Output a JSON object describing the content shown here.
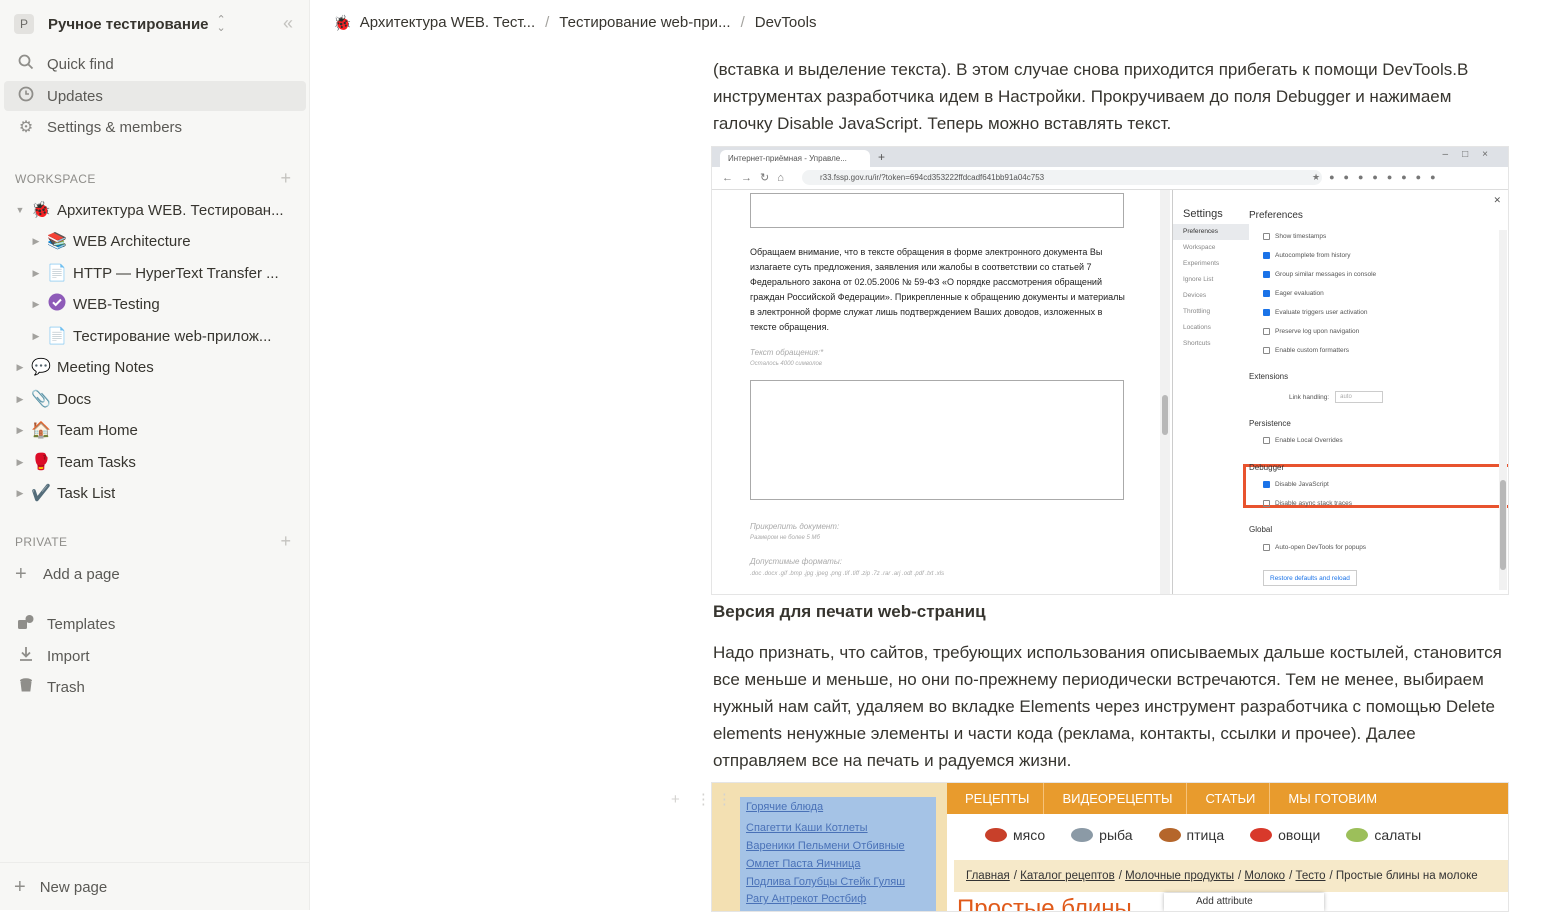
{
  "sidebar": {
    "workspace_initial": "P",
    "workspace_name": "Ручное тестирование",
    "nav": [
      {
        "label": "Quick find",
        "icon": "search-icon"
      },
      {
        "label": "Updates",
        "icon": "clock-icon"
      },
      {
        "label": "Settings & members",
        "icon": "gear-icon"
      }
    ],
    "workspace_header": "WORKSPACE",
    "tree": [
      {
        "label": "Архитектура WEB. Тестирован...",
        "emoji": "🐞",
        "level": 0,
        "expanded": true
      },
      {
        "label": "WEB Architecture",
        "emoji": "📚",
        "level": 1
      },
      {
        "label": "HTTP — HyperText Transfer ...",
        "emoji": "📄",
        "level": 1
      },
      {
        "label": "WEB-Testing",
        "emoji": "✅",
        "level": 1
      },
      {
        "label": "Тестирование web-прилож...",
        "emoji": "📄",
        "level": 1
      },
      {
        "label": "Meeting Notes",
        "emoji": "💬",
        "level": 0
      },
      {
        "label": "Docs",
        "emoji": "📎",
        "level": 0
      },
      {
        "label": "Team Home",
        "emoji": "🏠",
        "level": 0
      },
      {
        "label": "Team Tasks",
        "emoji": "🥊",
        "level": 0
      },
      {
        "label": "Task List",
        "emoji": "✔️",
        "level": 0
      }
    ],
    "private_header": "PRIVATE",
    "add_page": "Add a page",
    "bottom": [
      {
        "label": "Templates",
        "icon": "templates-icon"
      },
      {
        "label": "Import",
        "icon": "import-icon"
      },
      {
        "label": "Trash",
        "icon": "trash-icon"
      }
    ],
    "new_page": "New page"
  },
  "breadcrumb": [
    {
      "label": "Архитектура WEB. Тест...",
      "emoji": "🐞"
    },
    {
      "label": "Тестирование web-при..."
    },
    {
      "label": "DevTools"
    }
  ],
  "content": {
    "para1": "(вставка и выделение текста). В этом случае снова приходится прибегать к помощи DevTools.В инструментах разработчика идем в Настройки. Прокручиваем до поля Debugger и нажимаем галочку Disable JavaScript. Теперь можно вставлять текст.",
    "heading": "Версия для печати web-страниц",
    "para2": "Надо признать, что сайтов, требующих использования описываемых дальше костылей, становится все меньше и меньше, но они по-прежнему периодически встречаются. Тем не менее, выбираем нужный нам сайт, удаляем во вкладке Elements через инструмент разработчика с помощью Delete elements ненужные элементы и части кода (реклама, контакты, ссылки и прочее). Далее отправляем все на печать и радуемся жизни."
  },
  "screenshot1": {
    "tab_title": "Интернет-приёмная - Управле...",
    "url": "r33.fssp.gov.ru/ir/?token=694cd353222ffdcadf641bb91a04c753",
    "notice": "Обращаем внимание, что в тексте обращения в форме электронного документа Вы излагаете суть предложения, заявления или жалобы в соответствии со статьей 7 Федерального закона от 02.05.2006 № 59-ФЗ «О порядке рассмотрения обращений граждан Российской Федерации». Прикрепленные к обращению документы и материалы в электронной форме служат лишь подтверждением Ваших доводов, изложенных в тексте обращения.",
    "text_label": "Текст обращения:*",
    "text_hint": "Осталось 4000 символов",
    "attach_label": "Прикрепить документ:",
    "attach_hint": "Размером не более 5 Мб",
    "formats_label": "Допустимые форматы:",
    "formats": ".doc .docx .gif .bmp .jpg .jpeg .png .tif .tiff .zip .7z .rar .arj .odt .pdf .txt .xls",
    "settings_title": "Settings",
    "settings_menu": [
      "Preferences",
      "Workspace",
      "Experiments",
      "Ignore List",
      "Devices",
      "Throttling",
      "Locations",
      "Shortcuts"
    ],
    "prefs_title": "Preferences",
    "checkboxes_top": [
      {
        "label": "Show timestamps",
        "on": false
      },
      {
        "label": "Autocomplete from history",
        "on": true
      },
      {
        "label": "Group similar messages in console",
        "on": true
      },
      {
        "label": "Eager evaluation",
        "on": true
      },
      {
        "label": "Evaluate triggers user activation",
        "on": true
      },
      {
        "label": "Preserve log upon navigation",
        "on": false
      },
      {
        "label": "Enable custom formatters",
        "on": false
      }
    ],
    "extensions": "Extensions",
    "link_handling": "Link handling:",
    "link_value": "auto",
    "persistence": "Persistence",
    "enable_overrides": "Enable Local Overrides",
    "debugger": "Debugger",
    "disable_js": "Disable JavaScript",
    "disable_async": "Disable async stack traces",
    "global": "Global",
    "auto_open": "Auto-open DevTools for popups",
    "restore": "Restore defaults and reload"
  },
  "screenshot2": {
    "side_links": [
      "Горячие блюда",
      "Спагетти  Каши  Котлеты",
      "Вареники  Пельмени  Отбивные",
      "Омлет  Паста  Яичница",
      "Подлива  Голубцы  Стейк  Гуляш",
      "Рагу  Антрекот  Ростбиф"
    ],
    "menu": [
      "РЕЦЕПТЫ",
      "ВИДЕОРЕЦЕПТЫ",
      "СТАТЬИ",
      "МЫ ГОТОВИМ"
    ],
    "cats": [
      {
        "label": "мясо",
        "color": "#c8402a"
      },
      {
        "label": "рыба",
        "color": "#8b9aa6"
      },
      {
        "label": "птица",
        "color": "#b5662b"
      },
      {
        "label": "овощи",
        "color": "#d8392b"
      },
      {
        "label": "салаты",
        "color": "#9cbf5a"
      }
    ],
    "crumbs": [
      "Главная",
      "Каталог рецептов",
      "Молочные продукты",
      "Молоко",
      "Тесто"
    ],
    "crumb_tail": "/ Простые блины на молоке",
    "title": "Простые блины",
    "add_attribute": "Add attribute"
  },
  "colors": {
    "sidebar_bg": "#f7f7f5",
    "highlight": "#e8532e",
    "recipe_orange": "#e89b2d"
  }
}
